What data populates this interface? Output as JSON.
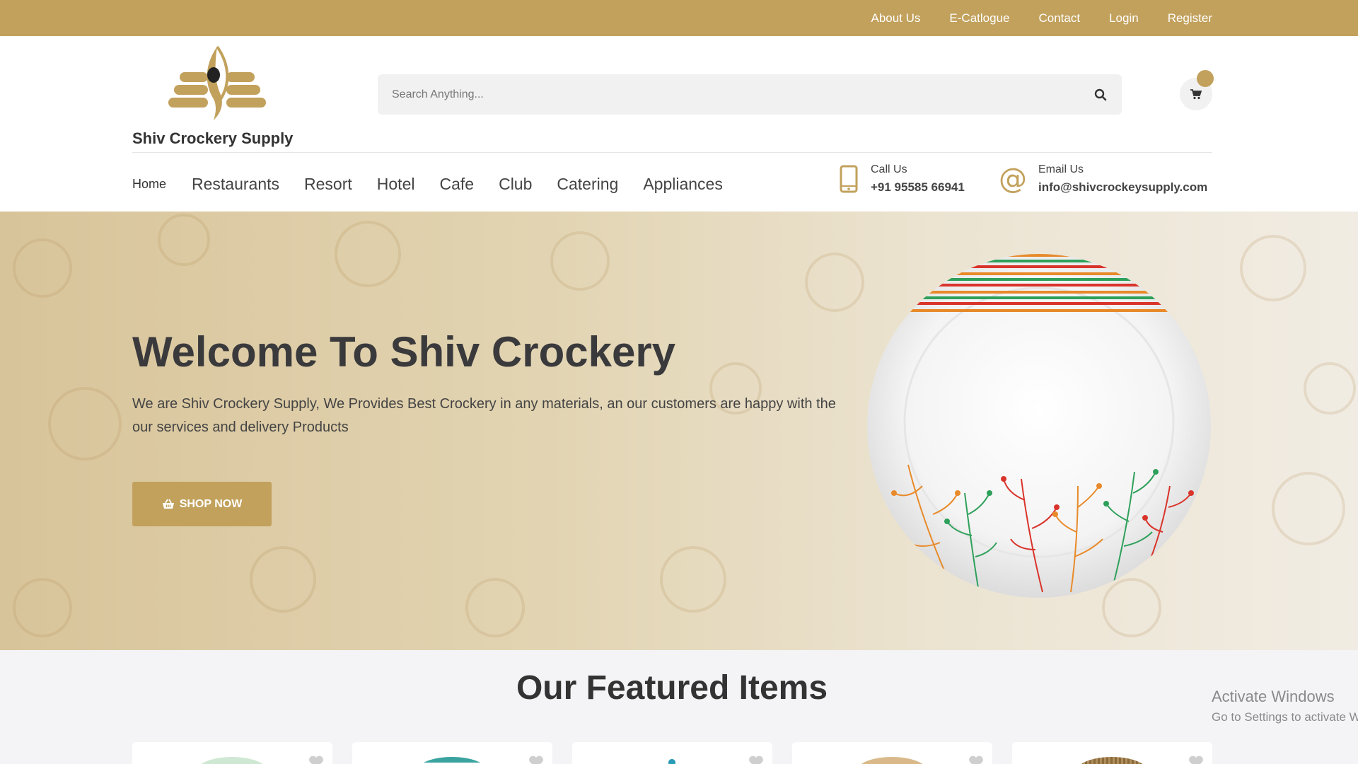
{
  "topbar": {
    "links": [
      "About Us",
      "E-Catlogue",
      "Contact",
      "Login",
      "Register"
    ]
  },
  "brand": {
    "name": "Shiv Crockery Supply"
  },
  "search": {
    "placeholder": "Search Anything...",
    "value": ""
  },
  "nav": {
    "home": "Home",
    "items": [
      "Restaurants",
      "Resort",
      "Hotel",
      "Cafe",
      "Club",
      "Catering",
      "Appliances"
    ]
  },
  "contact": {
    "call_label": "Call Us",
    "call_value": "+91 95585 66941",
    "email_label": "Email Us",
    "email_value": "info@shivcrockeysupply.com"
  },
  "hero": {
    "title": "Welcome To Shiv Crockery",
    "text": "We are Shiv Crockery Supply, We Provides Best Crockery in any materials, an our customers are happy with the our services and delivery Products",
    "button": "SHOP NOW"
  },
  "featured": {
    "title": "Our Featured Items"
  },
  "watermark": {
    "line1": "Activate Windows",
    "line2": "Go to Settings to activate Windows."
  },
  "colors": {
    "brand": "#c2a15c",
    "text": "#333333"
  },
  "icons": {
    "search": "search-icon",
    "cart": "cart-icon",
    "phone": "phone-icon",
    "email": "at-icon",
    "shop": "basket-icon",
    "wishlist": "heart-icon"
  }
}
